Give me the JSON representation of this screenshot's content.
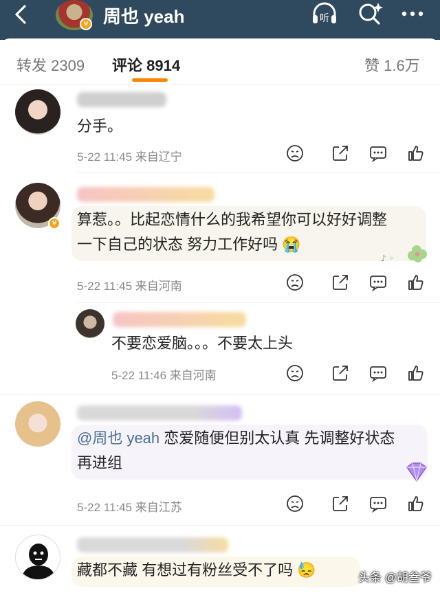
{
  "header": {
    "user_name": "周也 yeah",
    "verified_badge": "v",
    "icons": [
      "back-icon",
      "listen-icon",
      "search-icon",
      "more-icon"
    ],
    "listen_label": "听",
    "bg_color": "#2f4a5e"
  },
  "tabs": [
    {
      "label": "转发 2309"
    },
    {
      "label": "评论 8914"
    },
    {
      "label": "赞 1.6万"
    }
  ],
  "comments": [
    {
      "text": "分手。",
      "meta": "5-22 11:45  来自辽宁"
    },
    {
      "text_line1": "算惹。。比起恋情什么的我希望你可以好好调整",
      "text_line2": "一下自己的状态 努力工作好吗",
      "emoji": "😭",
      "meta": "5-22 11:45  来自河南"
    },
    {
      "text": "不要恋爱脑。。。不要太上头",
      "meta": "5-22 11:46  来自河南"
    },
    {
      "mention": "@周也 yeah",
      "text_line1": " 恋爱随便但别太认真 先调整好状态",
      "text_line2": "再进组",
      "meta": "5-22 11:45  来自江苏"
    },
    {
      "text": "藏都不藏 有想过有粉丝受不了吗",
      "emoji": "😓"
    }
  ],
  "accent_color": "#ff8200",
  "watermark": "头条 @胡叁爷"
}
